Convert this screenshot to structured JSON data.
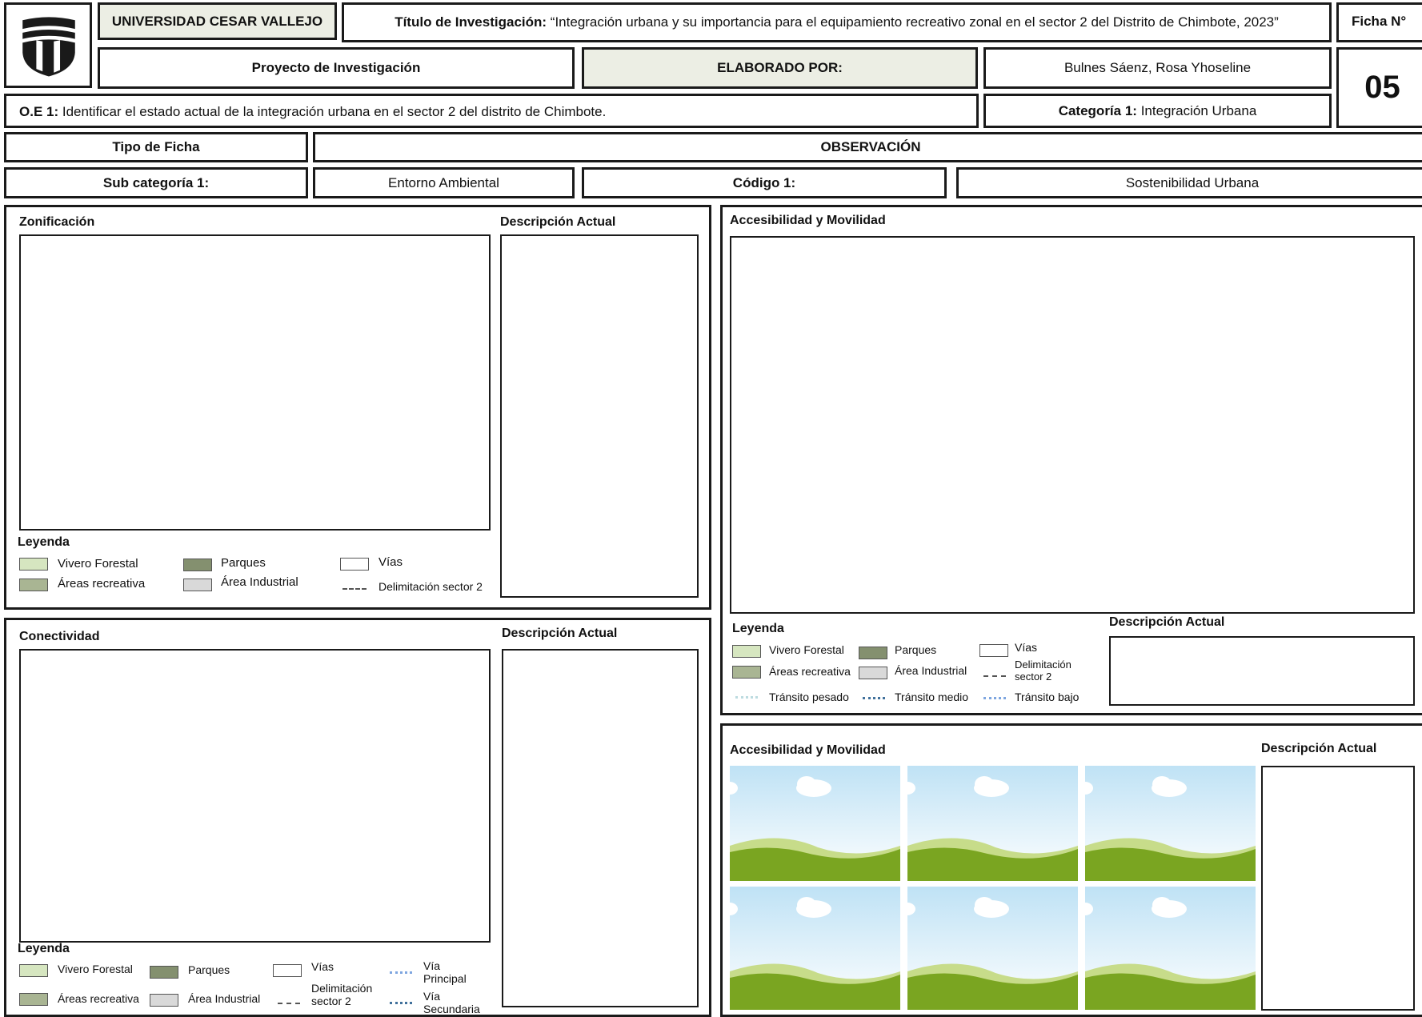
{
  "header": {
    "university": "UNIVERSIDAD CESAR VALLEJO",
    "title_label": "Título de Investigación:",
    "title_value": "“Integración urbana y su importancia para el equipamiento recreativo zonal en el sector 2 del Distrito de Chimbote, 2023”",
    "ficha_label": "Ficha N°",
    "ficha_number": "05",
    "project": "Proyecto de Investigación",
    "elaborado_label": "ELABORADO POR:",
    "author": "Bulnes Sáenz, Rosa Yhoseline",
    "oe_label": "O.E 1:",
    "oe_text": "Identificar el estado actual de la integración urbana en el sector 2 del distrito de Chimbote.",
    "categoria_label": "Categoría 1:",
    "categoria_value": "Integración Urbana",
    "tipo_label": "Tipo de Ficha",
    "tipo_value": "OBSERVACIÓN",
    "subcat_label": "Sub categoría 1:",
    "subcat_value": "Entorno Ambiental",
    "codigo_label": "Código 1:",
    "codigo_value": "Sostenibilidad Urbana"
  },
  "zonificacion": {
    "title": "Zonificación",
    "desc_title": "Descripción Actual",
    "legend_title": "Leyenda",
    "legend": {
      "vivero": "Vivero Forestal",
      "areas": "Áreas recreativa",
      "parques": "Parques",
      "industrial": "Área Industrial",
      "vias": "Vías",
      "delim": "Delimitación sector 2"
    }
  },
  "conectividad": {
    "title": "Conectividad",
    "desc_title": "Descripción Actual",
    "legend_title": "Leyenda",
    "legend": {
      "vivero": "Vivero Forestal",
      "areas": "Áreas recreativa",
      "parques": "Parques",
      "industrial": "Área Industrial",
      "vias": "Vías",
      "delim_1": "Delimitación",
      "delim_2": "sector 2",
      "via_p1": "Vía",
      "via_p2": "Principal",
      "via_s1": "Vía",
      "via_s2": "Secundaria"
    }
  },
  "accesibilidad": {
    "title": "Accesibilidad y Movilidad",
    "desc_title": "Descripción Actual",
    "legend_title": "Leyenda",
    "legend": {
      "vivero": "Vivero Forestal",
      "areas": "Áreas recreativa",
      "parques": "Parques",
      "industrial": "Área Industrial",
      "vias": "Vías",
      "delim_1": "Delimitación",
      "delim_2": "sector 2",
      "pesado": "Tránsito pesado",
      "medio": "Tránsito medio",
      "bajo": "Tránsito bajo"
    }
  },
  "fotos": {
    "title": "Accesibilidad y Movilidad",
    "desc_title": "Descripción Actual"
  },
  "colors": {
    "vivero": "#d6e6c0",
    "areas": "#a9b593",
    "parques": "#84906f",
    "industrial": "#d9d9d9",
    "header_shade": "#eceee4",
    "sky": "#bfe2f5",
    "grass": "#7aa521",
    "trafico_pesado": "#bcdbe0",
    "trafico_medio": "#41719c",
    "trafico_bajo": "#7ea6e0"
  },
  "icons": [
    "university-logo-icon",
    "landscape-placeholder-icon"
  ]
}
